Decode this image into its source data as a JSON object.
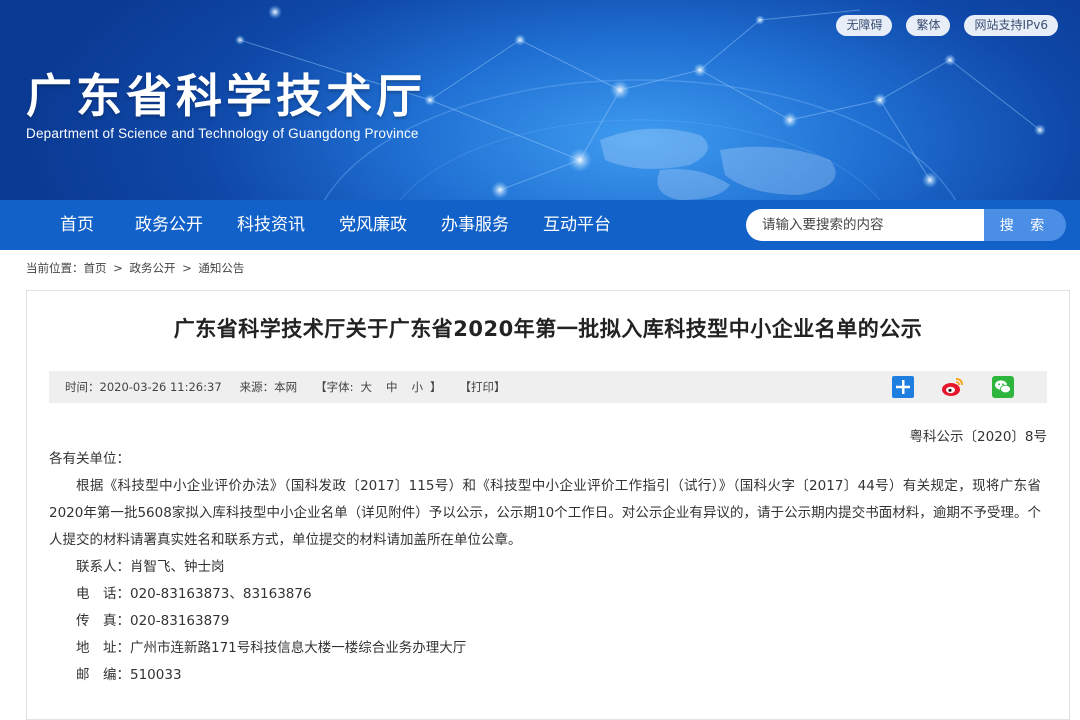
{
  "header": {
    "title": "广东省科学技术厅",
    "subtitle": "Department of Science and Technology of Guangdong Province",
    "top_links": [
      "无障碍",
      "繁体",
      "网站支持IPv6"
    ]
  },
  "nav": {
    "items": [
      "首页",
      "政务公开",
      "科技资讯",
      "党风廉政",
      "办事服务",
      "互动平台"
    ],
    "search_placeholder": "请输入要搜索的内容",
    "search_button": "搜 索"
  },
  "breadcrumb": {
    "label": "当前位置：",
    "items": [
      "首页",
      "政务公开",
      "通知公告"
    ],
    "sep": ">"
  },
  "article": {
    "title": "广东省科学技术厅关于广东省2020年第一批拟入库科技型中小企业名单的公示",
    "meta": {
      "time": "时间：2020-03-26 11:26:37",
      "source": "来源：本网",
      "font_label": "【字体:",
      "size_large": "大",
      "size_medium": "中",
      "size_small": "小",
      "font_close": "】",
      "print": "【打印】"
    },
    "share_icons": [
      "plus-share-icon",
      "weibo-icon",
      "wechat-icon"
    ],
    "doc_number": "粤科公示〔2020〕8号",
    "salutation": "各有关单位：",
    "paragraph": "根据《科技型中小企业评价办法》（国科发政〔2017〕115号）和《科技型中小企业评价工作指引（试行）》（国科火字〔2017〕44号）有关规定，现将广东省2020年第一批5608家拟入库科技型中小企业名单（详见附件）予以公示，公示期10个工作日。对公示企业有异议的，请于公示期内提交书面材料，逾期不予受理。个人提交的材料请署真实姓名和联系方式，单位提交的材料请加盖所在单位公章。",
    "contacts": [
      "联系人：肖智飞、钟士岗",
      "电　话：020-83163873、83163876",
      "传　真：020-83163879",
      "地　址：广州市连新路171号科技信息大楼一楼综合业务办理大厅",
      "邮　编：510033"
    ]
  },
  "colors": {
    "nav_bg": "#1261c9",
    "banner_dark": "#0a3a93",
    "banner_light": "#3f9cf0",
    "search_button": "#4a8ee6"
  }
}
